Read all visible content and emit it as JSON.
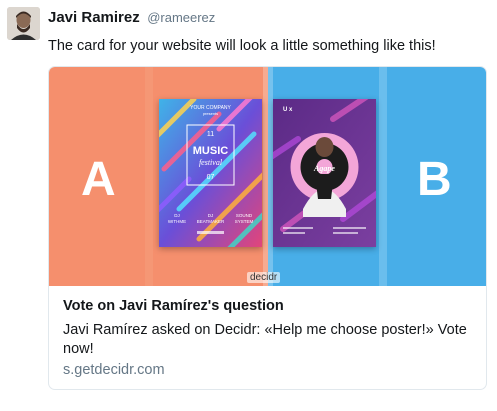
{
  "tweet": {
    "author_name": "Javi Ramirez",
    "author_handle": "@rameerez",
    "text": "The card for your website will look a little something like this!"
  },
  "card": {
    "option_a_letter": "A",
    "option_b_letter": "B",
    "poster_a": {
      "top_text": "YOUR COMPANY",
      "top_sub": "presents",
      "date": "11",
      "title_line1": "MUSIC",
      "title_line2": "festival",
      "month": "07",
      "acts": [
        "DJ",
        "DJ",
        "SOUND",
        "WITHME",
        "BEATMAKER",
        "SYSTEM"
      ]
    },
    "poster_b": {
      "top_text": "U x",
      "disc_text": "Agape"
    },
    "watermark": "decidr",
    "title": "Vote on Javi Ramírez's question",
    "description": "Javi Ramírez asked on Decidr: «Help me choose poster!» Vote now!",
    "url": "s.getdecidr.com"
  },
  "colors": {
    "panel_a": "#f58f6d",
    "panel_b": "#48aee8",
    "link_gray": "#657786"
  }
}
